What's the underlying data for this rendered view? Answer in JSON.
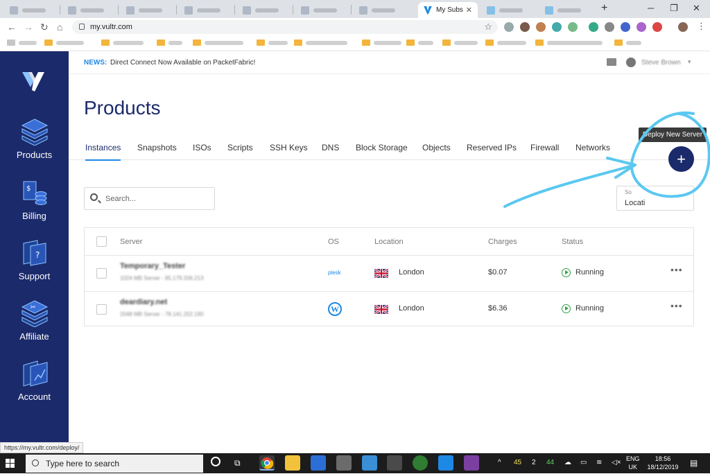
{
  "browser": {
    "active_tab_title": "My Subs",
    "url": "my.vultr.com",
    "status_url": "https://my.vultr.com/deploy/",
    "new_tab_symbol": "+"
  },
  "news": {
    "tag": "NEWS:",
    "text": "Direct Connect Now Available on PacketFabric!",
    "user_name": "Steve Brown"
  },
  "sidebar": {
    "items": [
      {
        "label": "Products",
        "icon": "products-icon"
      },
      {
        "label": "Billing",
        "icon": "billing-icon"
      },
      {
        "label": "Support",
        "icon": "support-icon"
      },
      {
        "label": "Affiliate",
        "icon": "affiliate-icon"
      },
      {
        "label": "Account",
        "icon": "account-icon"
      }
    ]
  },
  "page": {
    "title": "Products",
    "tabs": [
      "Instances",
      "Snapshots",
      "ISOs",
      "Scripts",
      "SSH Keys",
      "DNS",
      "Block Storage",
      "Objects",
      "Reserved IPs",
      "Firewall",
      "Networks"
    ],
    "active_tab": "Instances",
    "deploy_tooltip": "Deploy New Server",
    "deploy_symbol": "+",
    "search_placeholder": "Search...",
    "sort_label": "So",
    "sort_value": "Locati"
  },
  "table": {
    "headers": {
      "server": "Server",
      "os": "OS",
      "location": "Location",
      "charges": "Charges",
      "status": "Status"
    },
    "rows": [
      {
        "name": "Temporary_Tester",
        "detail": "1024 MB Server - 95.179.206.213",
        "os": "plesk",
        "location": "London",
        "charges": "$0.07",
        "status": "Running"
      },
      {
        "name": "deardiary.net",
        "detail": "2048 MB Server - 78.141.202.190",
        "os": "W",
        "location": "London",
        "charges": "$6.36",
        "status": "Running"
      }
    ],
    "more_symbol": "•••"
  },
  "taskbar": {
    "search_text": "Type here to search",
    "tray_numbers": [
      "45",
      "2",
      "44"
    ],
    "lang": "ENG",
    "region": "UK",
    "time": "18:56",
    "date": "18/12/2019"
  },
  "colors": {
    "sidebar": "#1b2a6b",
    "accent": "#1e88e5",
    "running": "#2ea043",
    "annotation": "#5bc8f0"
  }
}
